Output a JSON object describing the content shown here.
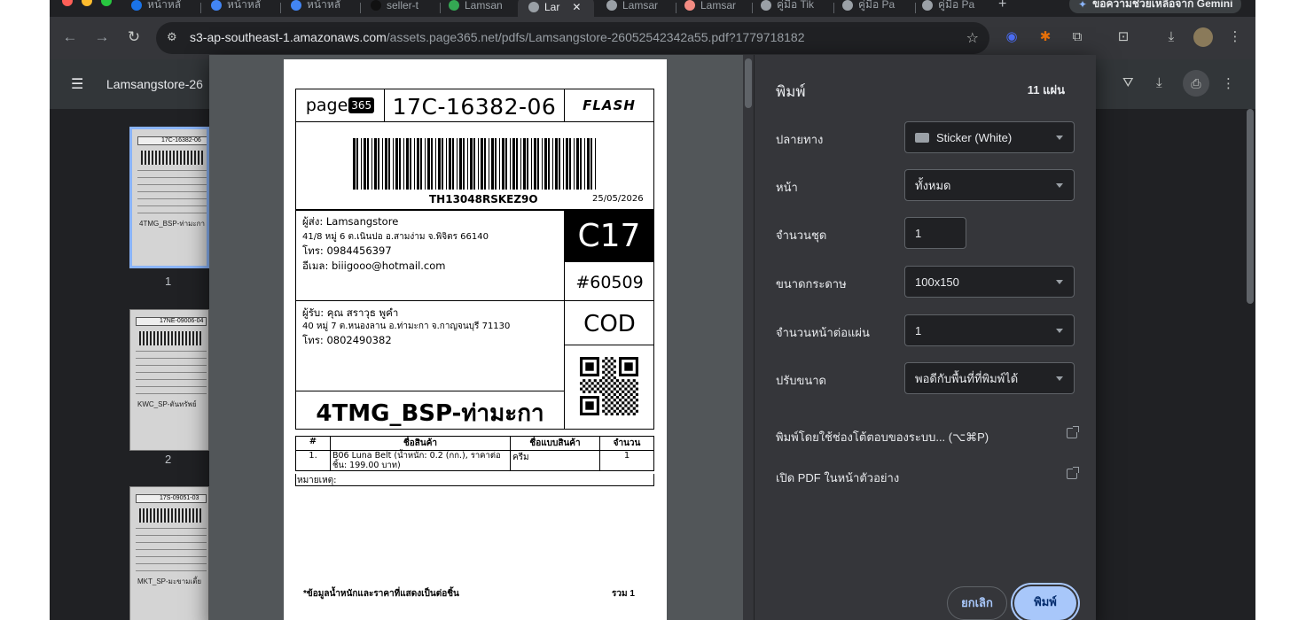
{
  "browser": {
    "tabs": [
      {
        "label": "หน้าหลั",
        "color": "#1a73e8"
      },
      {
        "label": "หน้าหลั",
        "color": "#4285f4"
      },
      {
        "label": "หน้าหลั",
        "color": "#4285f4"
      },
      {
        "label": "seller-t",
        "color": "#111111"
      },
      {
        "label": "Lamsan",
        "color": "#34a853"
      },
      {
        "label": "Lar",
        "color": "#9aa0a6"
      },
      {
        "label": "Lamsar",
        "color": "#9aa0a6"
      },
      {
        "label": "Lamsar",
        "color": "#f28b82"
      },
      {
        "label": "คู่มือ Tik",
        "color": "#9aa0a6"
      },
      {
        "label": "คู่มือ Pa",
        "color": "#9aa0a6"
      },
      {
        "label": "คู่มือ Pa",
        "color": "#9aa0a6"
      }
    ],
    "new_tab": "+",
    "gemini_label": "ขอความช่วยเหลือจาก Gemini",
    "url_host": "s3-ap-southeast-1.amazonaws.com",
    "url_path": "/assets.page365.net/pdfs/Lamsangstore-26052542342a55.pdf?1779718182"
  },
  "pdf_viewer": {
    "title": "Lamsangstore-26",
    "thumbnails": [
      {
        "num": "1",
        "header": "17C-16382-06",
        "tag": "4TMG_BSP-ท่ามะกา"
      },
      {
        "num": "2",
        "header": "17NE-09006-04",
        "tag": "KWC_SP-ตันทรัพย์"
      },
      {
        "num": "",
        "header": "17S-09051-03",
        "tag": "MKT_SP-มะขามเตี้ย"
      }
    ]
  },
  "label": {
    "brand_text": "page",
    "brand_num": "365",
    "tracking_code": "17C-16382-06",
    "carrier": "FLASH",
    "barcode_text": "TH13048RSKEZ9O",
    "date": "25/05/2026",
    "sender_name": "ผู้ส่ง: Lamsangstore",
    "sender_addr": "41/8 หมู่ 6 ต.เนินปอ อ.สามง่าม จ.พิจิตร 66140",
    "sender_phone": "โทร: 0984456397",
    "sender_email": "อีเมล: biiigooo@hotmail.com",
    "zone": "C17",
    "order_no": "#60509",
    "recv_name": "ผู้รับ: คุณ สราวุธ พูคำ",
    "recv_addr": "40 หมู่ 7 ต.หนองลาน อ.ท่ามะกา จ.กาญจนบุรี 71130",
    "recv_phone": "โทร: 0802490382",
    "payment": "COD",
    "dest_code": "4TMG_BSP-ท่ามะกา",
    "table_headers": [
      "#",
      "ชื่อสินค้า",
      "ชื่อแบบสินค้า",
      "จำนวน"
    ],
    "table_row": [
      "1.",
      "B06 Luna Belt (น้ำหนัก: 0.2 (กก.), ราคาต่อชิ้น: 199.00 บาท)",
      "ครีม",
      "1"
    ],
    "remark": "หมายเหตุ:",
    "footnote": "*ข้อมูลน้ำหนักและราคาที่แสดงเป็นต่อชิ้น",
    "total": "รวม 1"
  },
  "print": {
    "title": "พิมพ์",
    "sheets": "11 แผ่น",
    "destination_label": "ปลายทาง",
    "destination_value": "Sticker (White)",
    "pages_label": "หน้า",
    "pages_value": "ทั้งหมด",
    "copies_label": "จำนวนชุด",
    "copies_value": "1",
    "paper_label": "ขนาดกระดาษ",
    "paper_value": "100x150",
    "pps_label": "จำนวนหน้าต่อแผ่น",
    "pps_value": "1",
    "scale_label": "ปรับขนาด",
    "scale_value": "พอดีกับพื้นที่ที่พิมพ์ได้",
    "system_dialog": "พิมพ์โดยใช้ช่องโต้ตอบของระบบ... (⌥⌘P)",
    "open_pdf": "เปิด PDF ในหน้าตัวอย่าง",
    "cancel": "ยกเลิก",
    "print": "พิมพ์"
  }
}
